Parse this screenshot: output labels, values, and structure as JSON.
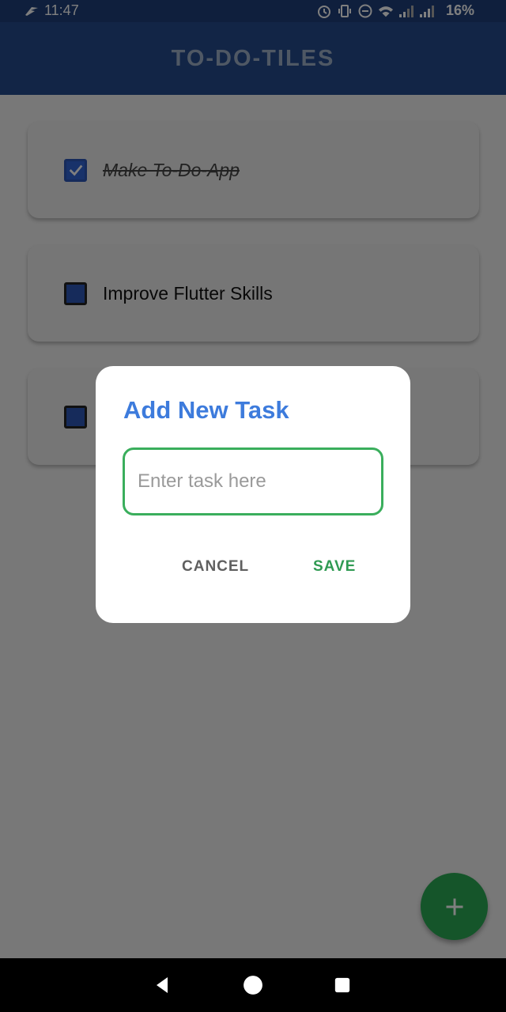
{
  "status": {
    "time": "11:47",
    "battery": "16%"
  },
  "app": {
    "title": "TO-DO-TILES"
  },
  "tasks": [
    {
      "label": "Make To-Do-App",
      "checked": true
    },
    {
      "label": "Improve Flutter Skills",
      "checked": false
    },
    {
      "label": "",
      "checked": false
    }
  ],
  "dialog": {
    "title": "Add New Task",
    "input_placeholder": "Enter task here",
    "input_value": "",
    "cancel_label": "CANCEL",
    "save_label": "SAVE"
  },
  "colors": {
    "app_bar": "#244a8c",
    "dialog_title": "#3d7bdc",
    "accent_green": "#2aaa54",
    "checkbox_blue": "#2d57b6"
  },
  "icons": {
    "fab": "plus-icon",
    "nav_back": "back-triangle-icon",
    "nav_home": "home-circle-icon",
    "nav_recents": "recents-square-icon"
  }
}
